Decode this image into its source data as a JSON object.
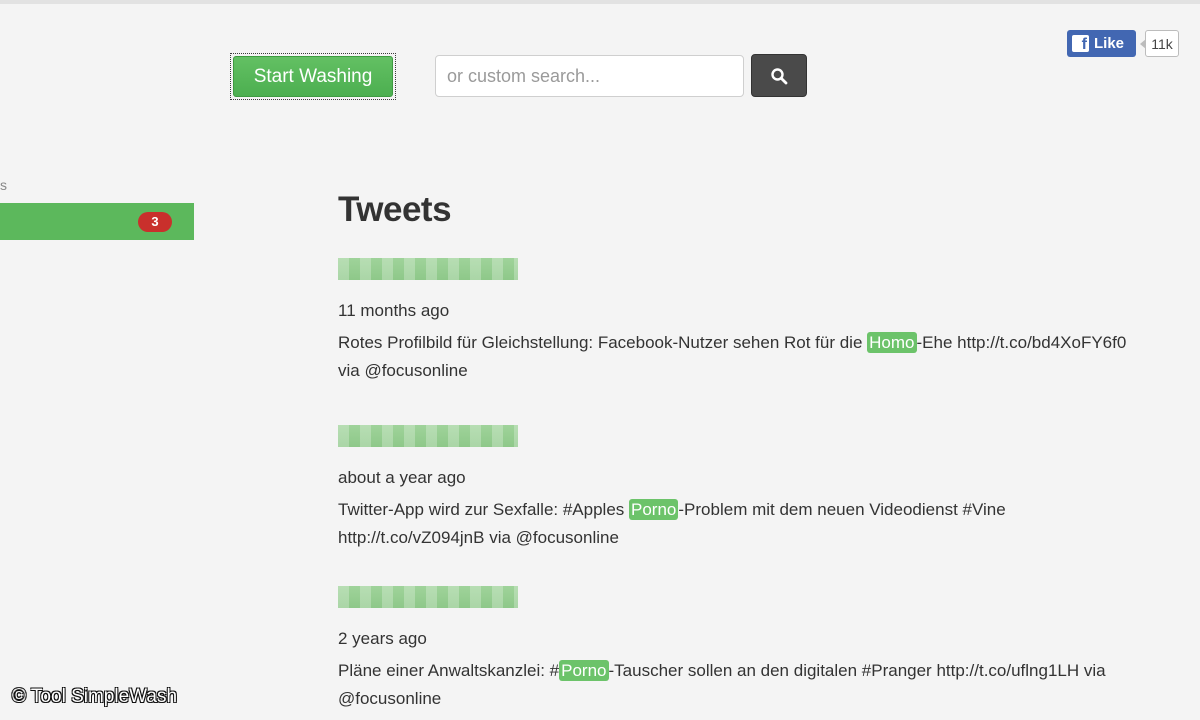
{
  "header": {
    "start_button": "Start Washing",
    "search_placeholder": "or custom search..."
  },
  "facebook": {
    "like_label": "Like",
    "like_count": "11k"
  },
  "sidebar": {
    "label_fragment": "s",
    "badge_count": "3"
  },
  "tweets": {
    "heading": "Tweets",
    "items": [
      {
        "time": "11 months ago",
        "before": "Rotes Profilbild für Gleichstellung: Facebook-Nutzer sehen Rot für die ",
        "highlight": "Homo",
        "after": "-Ehe http://t.co/bd4XoFY6f0 via @focusonline"
      },
      {
        "time": "about a year ago",
        "before": "Twitter-App wird zur Sexfalle: #Apples ",
        "highlight": "Porno",
        "after": "-Problem mit dem neuen Videodienst #Vine http://t.co/vZ094jnB via @focusonline"
      },
      {
        "time": "2 years ago",
        "before": "Pläne einer Anwaltskanzlei: #",
        "highlight": "Porno",
        "after": "-Tauscher sollen an den digitalen #Pranger http://t.co/uflng1LH via @focusonline"
      }
    ]
  },
  "credit": "© Tool SimpleWash",
  "colors": {
    "accent_green": "#5cb85c",
    "highlight_green": "#6cc36a",
    "badge_red": "#c9302c",
    "facebook_blue": "#4267b2"
  }
}
